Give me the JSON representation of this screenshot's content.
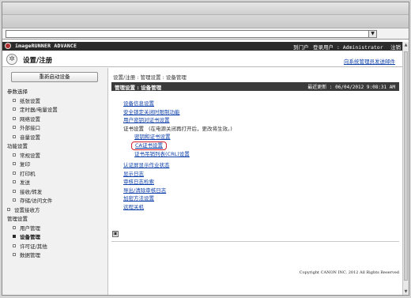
{
  "browser": {
    "address_value": "",
    "dropdown_glyph": "▼"
  },
  "header": {
    "brand": "imageRUNNER ADVANCE",
    "portal_label": "到门户",
    "login_user": "登录用户 : Administrator",
    "logout_label": "注销"
  },
  "title_bar": {
    "icon": "settings-wheel-icon",
    "title": "设置/注册",
    "email_link": "向系统管理员发送邮件"
  },
  "sidebar": {
    "restart_button": "重新启动设备",
    "sections": [
      {
        "heading": "参数选择",
        "items": [
          "纸张设置",
          "定时器/电量设置",
          "网络设置",
          "外部接口",
          "音量设置"
        ]
      },
      {
        "heading": "功能设置",
        "items": [
          "常规设置",
          "复印",
          "打印机",
          "发送",
          "接收/转发",
          "存储/访问文件"
        ]
      },
      {
        "heading": "",
        "items": [
          "设置接收方"
        ]
      },
      {
        "heading": "管理设置",
        "items": [
          "用户管理",
          "设备管理",
          "许可证/其他",
          "数据管理"
        ]
      }
    ],
    "active_item": "设备管理"
  },
  "main": {
    "breadcrumb": "设置/注册 : 管理设置 : 设备管理",
    "section_title": "管理设置 : 设备管理",
    "last_updated": "最近更新 : 06/04/2012 9:08:31 AM",
    "links_group_1": [
      "设备信息设置",
      "安全锁定关闭时限制功能",
      "用户密钥对证书设置"
    ],
    "cert_settings": {
      "label": "证书设置",
      "note": "(在电源关闭再打开后，更改将生效。)"
    },
    "cert_sub_links": {
      "key_cert": "密钥和证书设置",
      "ca_cert": "CA证书设置",
      "crl": "证书吊销列表(CRL)设置"
    },
    "links_group_2": [
      "认证屏显示作业状态",
      "显示日志",
      "审核日志检索",
      "导出/清除审核日志",
      "加密方法设置",
      "远程关机"
    ],
    "collapse_glyph": "▣",
    "copyright": "Copyright CANON INC. 2012 All Rights Reserved"
  },
  "colors": {
    "header_bg": "#2b2b2b",
    "link": "#0b3ea8",
    "highlight_circle": "#d4202a",
    "sidebar_bg": "#f1f1f1"
  }
}
